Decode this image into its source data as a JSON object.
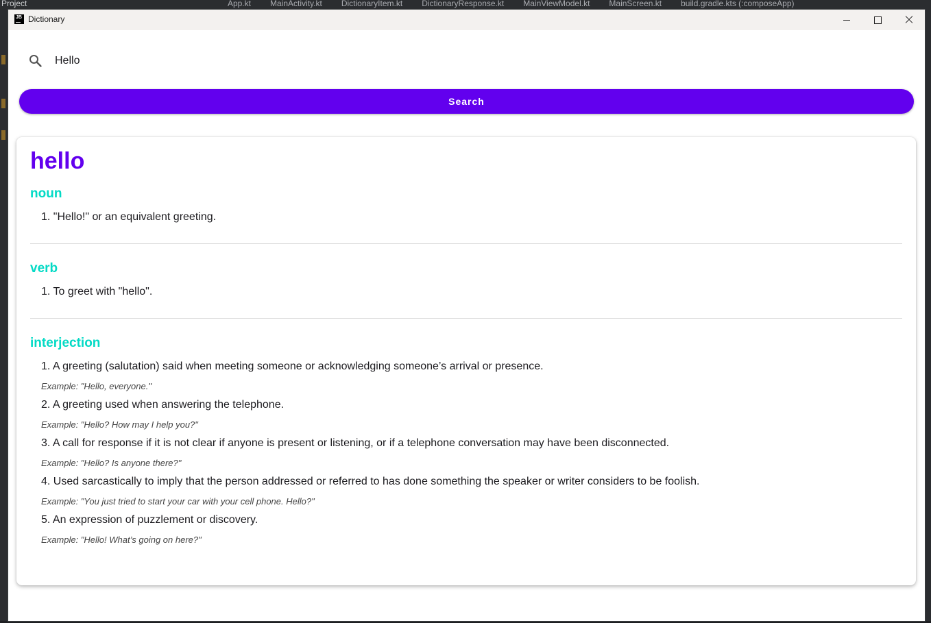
{
  "ide": {
    "project_label": "Project",
    "tabs": [
      "App.kt",
      "MainActivity.kt",
      "DictionaryItem.kt",
      "DictionaryResponse.kt",
      "MainViewModel.kt",
      "MainScreen.kt",
      "build.gradle.kts (:composeApp)"
    ]
  },
  "window": {
    "title": "Dictionary",
    "icon_text": "JB"
  },
  "search": {
    "value": "Hello",
    "button_label": "Search"
  },
  "entry": {
    "word": "hello",
    "meanings": [
      {
        "part_of_speech": "noun",
        "definitions": [
          {
            "text": "1. \"Hello!\" or an equivalent greeting."
          }
        ]
      },
      {
        "part_of_speech": "verb",
        "definitions": [
          {
            "text": "1. To greet with \"hello\"."
          }
        ]
      },
      {
        "part_of_speech": "interjection",
        "definitions": [
          {
            "text": "1. A greeting (salutation) said when meeting someone or acknowledging someone’s arrival or presence.",
            "example": "Example: \"Hello, everyone.\""
          },
          {
            "text": "2. A greeting used when answering the telephone.",
            "example": "Example: \"Hello? How may I help you?\""
          },
          {
            "text": "3. A call for response if it is not clear if anyone is present or listening, or if a telephone conversation may have been disconnected.",
            "example": "Example: \"Hello? Is anyone there?\""
          },
          {
            "text": "4. Used sarcastically to imply that the person addressed or referred to has done something the speaker or writer considers to be foolish.",
            "example": "Example: \"You just tried to start your car with your cell phone. Hello?\""
          },
          {
            "text": "5. An expression of puzzlement or discovery.",
            "example": "Example: \"Hello! What’s going on here?\""
          }
        ]
      }
    ]
  },
  "colors": {
    "primary": "#6200ee",
    "secondary": "#03dac5"
  }
}
